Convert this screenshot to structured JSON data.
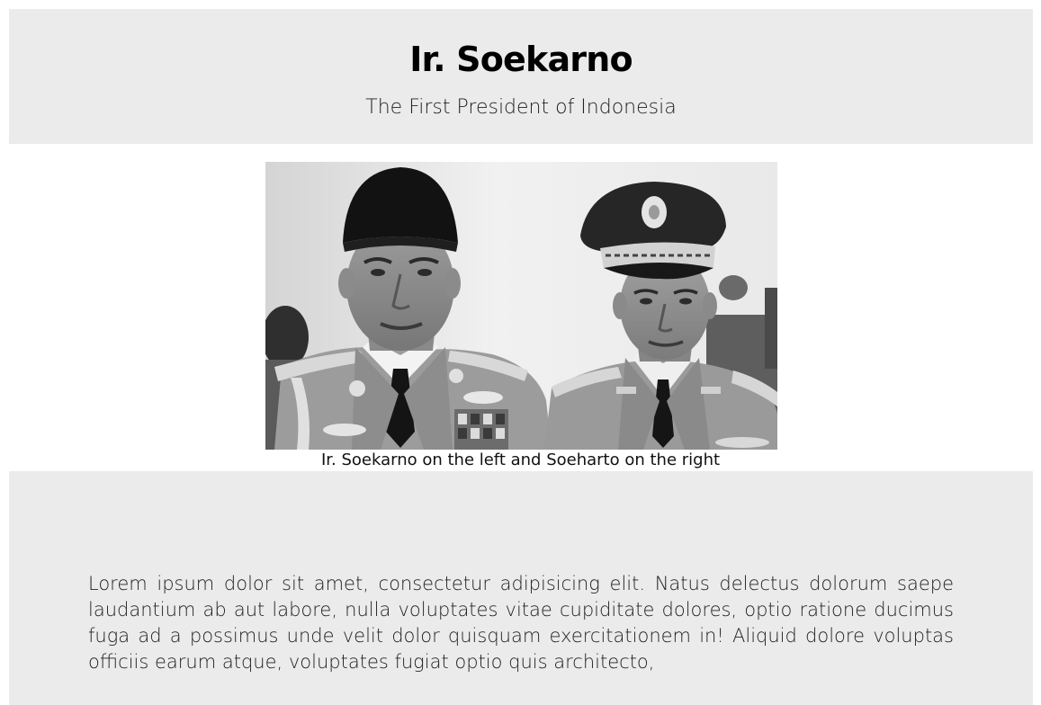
{
  "header": {
    "title": "Ir. Soekarno",
    "subtitle": "The First President of Indonesia"
  },
  "figure": {
    "caption": "Ir. Soekarno on the left and Soeharto on the right",
    "image_label": "Soekarno and Soeharto photograph"
  },
  "content": {
    "paragraph": "Lorem ipsum dolor sit amet, consectetur adipisicing elit. Natus delectus dolorum saepe laudantium ab aut labore, nulla voluptates vitae cupiditate dolores, optio ratione ducimus fuga ad a possimus unde velit dolor quisquam exercitationem in! Aliquid dolore voluptas officiis earum atque, voluptates fugiat optio quis architecto,"
  },
  "colors": {
    "panel_background": "#ebebeb",
    "page_background": "#ffffff",
    "text": "#111111"
  }
}
